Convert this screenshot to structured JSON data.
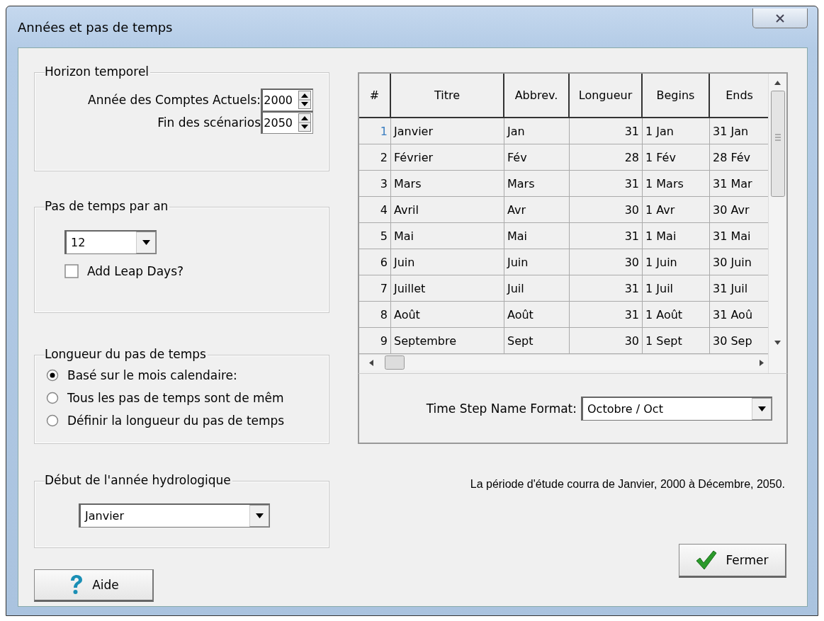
{
  "window": {
    "title": "Années et pas de temps"
  },
  "horizon": {
    "legend": "Horizon temporel",
    "fields": [
      {
        "label": "Année des Comptes Actuels:",
        "value": "2000"
      },
      {
        "label": "Fin des scénarios",
        "value": "2050"
      }
    ]
  },
  "steps_per_year": {
    "legend": "Pas de temps par an",
    "value": "12",
    "leap_days": {
      "label": "Add Leap Days?",
      "checked": false
    }
  },
  "step_length": {
    "legend": "Longueur du pas de temps",
    "options": [
      {
        "label": "Basé sur le mois calendaire:",
        "selected": true
      },
      {
        "label": "Tous les pas de temps sont de mêm",
        "selected": false
      },
      {
        "label": "Définir la longueur du pas de temps",
        "selected": false
      }
    ]
  },
  "water_year_start": {
    "legend": "Début de l'année hydrologique",
    "value": "Janvier"
  },
  "table": {
    "columns": [
      "#",
      "Titre",
      "Abbrev.",
      "Longueur",
      "Begins",
      "Ends"
    ],
    "rows": [
      {
        "cells": [
          "1",
          "Janvier",
          "Jan",
          "31",
          "1 Jan",
          "31 Jan"
        ],
        "selected": true
      },
      {
        "cells": [
          "2",
          "Février",
          "Fév",
          "28",
          "1 Fév",
          "28 Fév"
        ],
        "selected": false
      },
      {
        "cells": [
          "3",
          "Mars",
          "Mars",
          "31",
          "1 Mars",
          "31 Mar"
        ],
        "selected": false
      },
      {
        "cells": [
          "4",
          "Avril",
          "Avr",
          "30",
          "1 Avr",
          "30 Avr"
        ],
        "selected": false
      },
      {
        "cells": [
          "5",
          "Mai",
          "Mai",
          "31",
          "1 Mai",
          "31 Mai"
        ],
        "selected": false
      },
      {
        "cells": [
          "6",
          "Juin",
          "Juin",
          "30",
          "1 Juin",
          "30 Juin"
        ],
        "selected": false
      },
      {
        "cells": [
          "7",
          "Juillet",
          "Juil",
          "31",
          "1 Juil",
          "31 Juil"
        ],
        "selected": false
      },
      {
        "cells": [
          "8",
          "Août",
          "Août",
          "31",
          "1 Août",
          "31 Aoû"
        ],
        "selected": false
      },
      {
        "cells": [
          "9",
          "Septembre",
          "Sept",
          "30",
          "1 Sept",
          "30 Sep"
        ],
        "selected": false
      }
    ]
  },
  "name_format": {
    "label": "Time Step Name Format:",
    "value": "Octobre / Oct"
  },
  "message": "La période d'étude courra de Janvier, 2000 à Décembre, 2050.",
  "buttons": [
    {
      "kind": "help",
      "label": "Aide"
    },
    {
      "kind": "close",
      "label": "Fermer"
    }
  ]
}
